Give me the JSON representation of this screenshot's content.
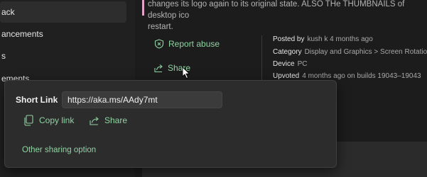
{
  "sidebar": {
    "items": [
      {
        "label": "ack",
        "active": true
      },
      {
        "label": "ancements"
      },
      {
        "label": "s"
      },
      {
        "label": "ements"
      }
    ]
  },
  "post": {
    "description": "changes its logo again to its original state. ALSO THe THUMBNAILS  of desktop ico\nrestart."
  },
  "actions": {
    "report_abuse": "Report abuse",
    "share": "Share"
  },
  "meta": {
    "posted_by_label": "Posted by",
    "posted_by_value": "kush k 4 months ago",
    "category_label": "Category",
    "category_value": "Display and Graphics > Screen Rotation a",
    "device_label": "Device",
    "device_value": "PC",
    "upvoted_label": "Upvoted",
    "upvoted_value": "4 months ago on builds 19043–19043"
  },
  "share_flyout": {
    "short_link_label": "Short Link",
    "short_link_value": "https://aka.ms/AAdy7mt",
    "copy_link": "Copy link",
    "share": "Share",
    "other_option": "Other sharing option"
  },
  "colors": {
    "accent": "#8fd4a2",
    "quote_bar": "#e2a3c8"
  }
}
